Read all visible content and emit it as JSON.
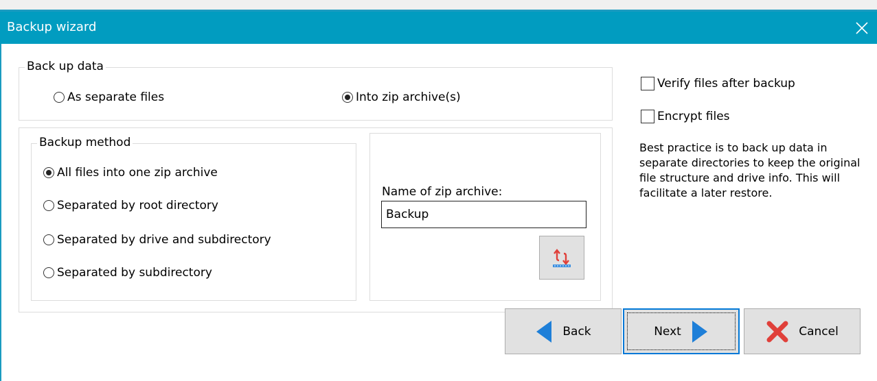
{
  "window": {
    "title": "Backup wizard"
  },
  "backup_data": {
    "legend": "Back up data",
    "options": [
      {
        "label": "As separate files",
        "selected": false
      },
      {
        "label": "Into zip archive(s)",
        "selected": true
      }
    ]
  },
  "backup_method": {
    "legend": "Backup method",
    "options": [
      {
        "label": "All files into one zip archive",
        "selected": true
      },
      {
        "label": "Separated by root directory",
        "selected": false
      },
      {
        "label": "Separated by drive and subdirectory",
        "selected": false
      },
      {
        "label": "Separated by subdirectory",
        "selected": false
      }
    ]
  },
  "zip": {
    "name_label": "Name of zip archive:",
    "name_value": "Backup",
    "refresh_icon": "refresh-archive-icon"
  },
  "options": {
    "verify_label": "Verify files after backup",
    "verify_checked": false,
    "encrypt_label": "Encrypt files",
    "encrypt_checked": false
  },
  "info_text": "Best practice is to back up data in separate directories to keep the original file structure and drive info. This will facilitate a later restore.",
  "buttons": {
    "back": "Back",
    "next": "Next",
    "cancel": "Cancel"
  },
  "colors": {
    "titlebar": "#019cc0",
    "arrow": "#1e7fd8",
    "cancel_x": "#e0403a"
  }
}
